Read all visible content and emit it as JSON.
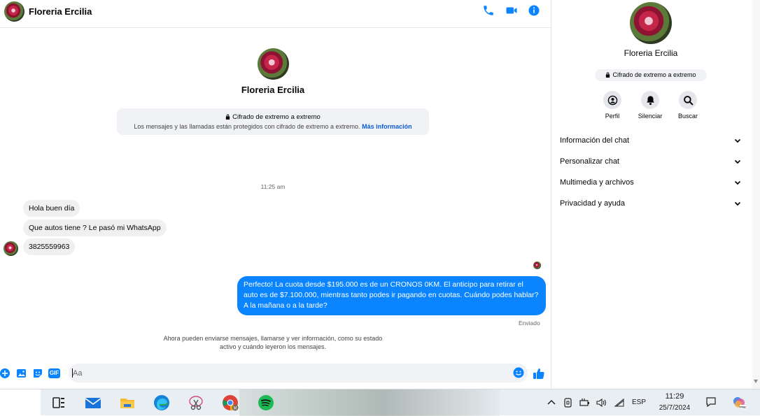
{
  "header": {
    "contact_name": "Floreria Ercilia"
  },
  "intro": {
    "contact_name": "Floreria Ercilia",
    "encryption_title": "Cifrado de extremo a extremo",
    "encryption_desc": "Los mensajes y las llamadas están protegidos con cifrado de extremo a extremo.",
    "more_info_link": "Más información"
  },
  "conversation": {
    "timestamp": "11:25 am",
    "incoming": [
      "Hola buen día",
      "Que autos tiene ? Le pasó mi WhatsApp",
      "3825559963"
    ],
    "outgoing": "Perfecto! La cuota desde $195.000 es de un CRONOS 0KM. El anticipo para retirar el auto es de $7.100.000, mientras tanto podes ir pagando en cuotas. Cuándo podes hablar? A la mañana o a la tarde?",
    "sent_status": "Enviado",
    "info_note": "Ahora pueden enviarse mensajes, llamarse y ver información, como su estado activo y cuándo leyeron los mensajes."
  },
  "composer": {
    "placeholder": "Aa",
    "gif_label": "GIF"
  },
  "panel": {
    "contact_name": "Floreria Ercilia",
    "encryption_badge": "Cifrado de extremo a extremo",
    "actions": [
      {
        "label": "Perfil",
        "icon": "profile-icon"
      },
      {
        "label": "Silenciar",
        "icon": "bell-icon"
      },
      {
        "label": "Buscar",
        "icon": "search-icon"
      }
    ],
    "sections": [
      "Información del chat",
      "Personalizar chat",
      "Multimedia y archivos",
      "Privacidad y ayuda"
    ]
  },
  "taskbar": {
    "language": "ESP",
    "time": "11:29",
    "date": "25/7/2024",
    "apps": [
      "task-view",
      "mail",
      "file-explorer",
      "edge",
      "snipping-tool",
      "chrome",
      "spotify"
    ]
  },
  "colors": {
    "accent": "#0a84ff",
    "bubble_in": "#f0f0f0",
    "bubble_out": "#0a84ff"
  }
}
